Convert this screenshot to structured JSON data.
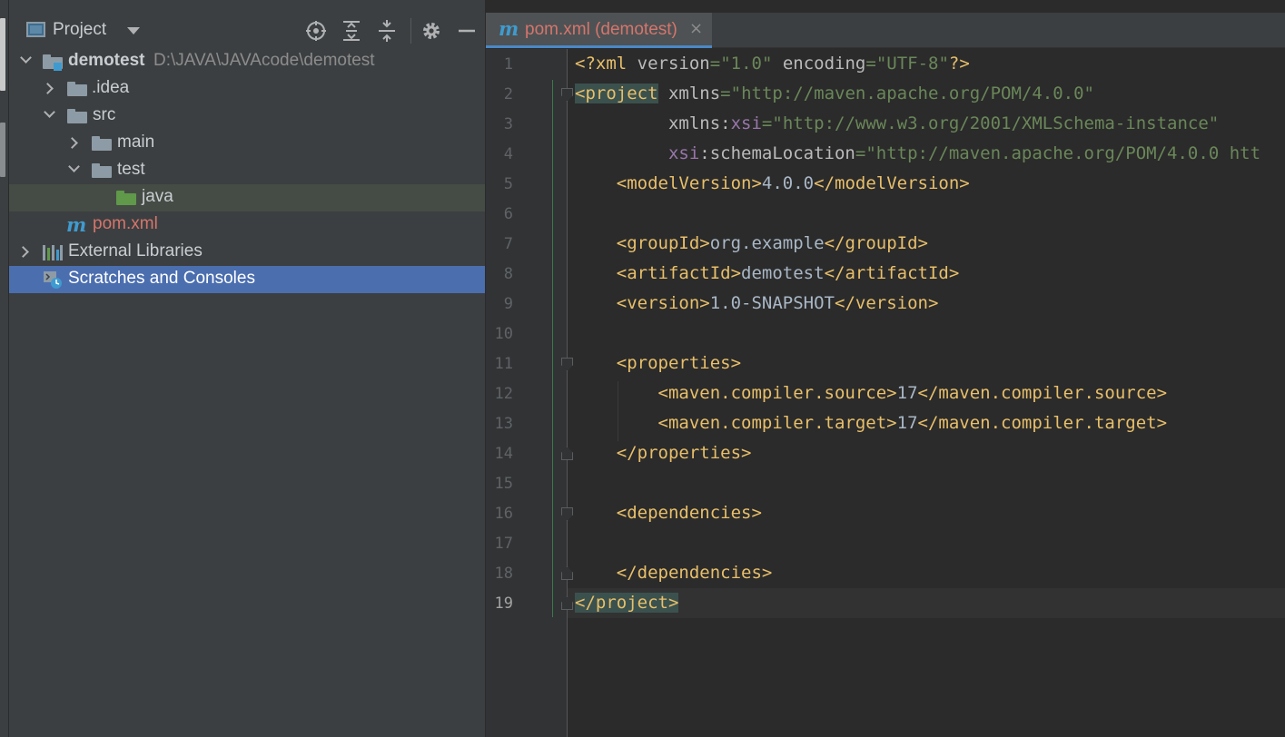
{
  "project_panel": {
    "title": "Project",
    "toolbar_icons": [
      "locate-icon",
      "expand-all-icon",
      "collapse-all-icon",
      "gear-icon",
      "minimize-icon"
    ],
    "tree": [
      {
        "label": "demotest",
        "path": "D:\\JAVA\\JAVAcode\\demotest",
        "icon": "module-folder-icon",
        "state": "expanded"
      },
      {
        "label": ".idea",
        "icon": "folder-icon",
        "state": "collapsed"
      },
      {
        "label": "src",
        "icon": "folder-icon",
        "state": "expanded"
      },
      {
        "label": "main",
        "icon": "folder-icon",
        "state": "collapsed"
      },
      {
        "label": "test",
        "icon": "folder-icon",
        "state": "expanded"
      },
      {
        "label": "java",
        "icon": "test-sources-folder-icon",
        "state": "leaf"
      },
      {
        "label": "pom.xml",
        "icon": "maven-icon",
        "state": "leaf"
      },
      {
        "label": "External Libraries",
        "icon": "libraries-icon",
        "state": "collapsed"
      },
      {
        "label": "Scratches and Consoles",
        "icon": "scratches-icon",
        "state": "leaf",
        "selected": true
      }
    ]
  },
  "editor": {
    "tab": {
      "label": "pom.xml (demotest)",
      "close": "×",
      "icon": "maven-icon"
    },
    "active_line": "19",
    "line_numbers": [
      "1",
      "2",
      "3",
      "4",
      "5",
      "6",
      "7",
      "8",
      "9",
      "10",
      "11",
      "12",
      "13",
      "14",
      "15",
      "16",
      "17",
      "18",
      "19"
    ],
    "code": {
      "l1_decl": "<?xml",
      "l1_a1": "version",
      "l1_v1": "\"1.0\"",
      "l1_a2": "encoding",
      "l1_v2": "\"UTF-8\"",
      "l1_end": "?>",
      "l2_tag": "<project",
      "l2_a": "xmlns",
      "l2_v": "\"http://maven.apache.org/POM/4.0.0\"",
      "l3_a": "xmlns:",
      "l3_ns": "xsi",
      "l3_v": "\"http://www.w3.org/2001/XMLSchema-instance\"",
      "l4_ns": "xsi",
      "l4_a": ":schemaLocation",
      "l4_v": "\"http://maven.apache.org/POM/4.0.0 htt",
      "l5_open": "<modelVersion>",
      "l5_text": "4.0.0",
      "l5_close": "</modelVersion>",
      "l7_open": "<groupId>",
      "l7_text": "org.example",
      "l7_close": "</groupId>",
      "l8_open": "<artifactId>",
      "l8_text": "demotest",
      "l8_close": "</artifactId>",
      "l9_open": "<version>",
      "l9_text": "1.0-SNAPSHOT",
      "l9_close": "</version>",
      "l11": "<properties>",
      "l12_open": "<maven.compiler.source>",
      "l12_text": "17",
      "l12_close": "</maven.compiler.source>",
      "l13_open": "<maven.compiler.target>",
      "l13_text": "17",
      "l13_close": "</maven.compiler.target>",
      "l14": "</properties>",
      "l16": "<dependencies>",
      "l18": "</dependencies>",
      "l19": "</project>"
    }
  },
  "colors": {
    "tag": "#e8bf6a",
    "attr_value": "#6a8759",
    "namespace": "#9876aa",
    "selection_blue": "#4b6eaf",
    "modified_file": "#d5756c"
  }
}
